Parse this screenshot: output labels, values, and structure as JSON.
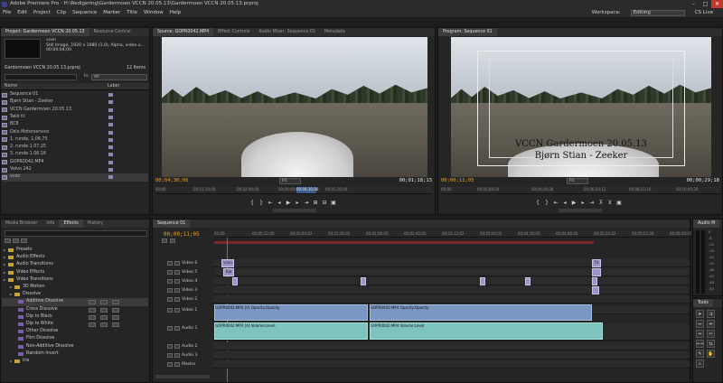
{
  "window": {
    "title": "Adobe Premiere Pro - H:\\Redigering\\Gardermoen VCCN 20.05.13\\Gardermoen VCCN 20.05.13.prproj",
    "minimize": "–",
    "maximize": "□",
    "close": "✕"
  },
  "menu": [
    "File",
    "Edit",
    "Project",
    "Clip",
    "Sequence",
    "Marker",
    "Title",
    "Window",
    "Help"
  ],
  "workspace": {
    "label": "Workspace:",
    "value": "Editing",
    "cs_live": "CS Live"
  },
  "project_panel": {
    "tabs": [
      "Project: Gardermoen VCCN 20.05.13",
      "Resource Central"
    ],
    "clip_name": "vcon",
    "clip_info": "Still Image, 1920 x 1080 (1.0), Alpha",
    "clip_extra": ", video u...",
    "clip_duration": "00;00;04;00",
    "project_file": "Gardermoen VCCN 20.05.13.prproj",
    "items_count": "12 Items",
    "in_label": "In:",
    "in_value": "All",
    "col_name": "Name",
    "col_label": "Label",
    "items": [
      "Sequence 01",
      "Bjørn Stian - Zeeker",
      "VCCN Gardermoen 20.05.13",
      "Takk til",
      "BC8",
      "Oslo Motorservice",
      "1. runde, 1.06.75",
      "2. runde 1.07.25",
      "3. runde 1.06.16",
      "GOPR0042.MP4",
      "Volvo 242",
      "vcon"
    ]
  },
  "source_monitor": {
    "tabs": [
      "Source: GOPR0042.MP4",
      "Effect Controls",
      "Audio Mixer: Sequence 01",
      "Metadata"
    ],
    "timecode_in": "00;04;30;06",
    "fit": "Fit",
    "timecode_dur": "00;01;18;13",
    "ruler": [
      "00;00",
      "00;01;20;00",
      "00;02;40;00",
      "00;04;00;00",
      "00;05;20;00"
    ],
    "ruler_marker": "00;04;30;00"
  },
  "program_monitor": {
    "tabs": [
      "Program: Sequence 01"
    ],
    "timecode_in": "00;00;11;05",
    "fit": "Fit",
    "timecode_dur": "00;00;29;18",
    "title_line1": "VCCN Gardermoen 20.05.13",
    "title_line2": "Bjørn Stian - Zeeker",
    "ruler": [
      "00;00",
      "00;02;08;04",
      "00;04;16;08",
      "00;06;24;12",
      "00;08;32;16",
      "00;10;40;20"
    ]
  },
  "effects_panel": {
    "tabs": [
      "Media Browser",
      "Info",
      "Effects",
      "History"
    ],
    "rows": [
      {
        "t": "Presets",
        "k": "folder"
      },
      {
        "t": "Audio Effects",
        "k": "folder"
      },
      {
        "t": "Audio Transitions",
        "k": "folder"
      },
      {
        "t": "Video Effects",
        "k": "folder"
      },
      {
        "t": "Video Transitions",
        "k": "folder"
      },
      {
        "t": "3D Motion",
        "k": "sub"
      },
      {
        "t": "Dissolve",
        "k": "sub"
      },
      {
        "t": "Additive Dissolve",
        "k": "eff"
      },
      {
        "t": "Cross Dissolve",
        "k": "eff"
      },
      {
        "t": "Dip to Black",
        "k": "eff"
      },
      {
        "t": "Dip to White",
        "k": "eff"
      },
      {
        "t": "Other Dissolve",
        "k": "eff"
      },
      {
        "t": "Film Dissolve",
        "k": "eff"
      },
      {
        "t": "Non-Additive Dissolve",
        "k": "eff"
      },
      {
        "t": "Random Invert",
        "k": "eff"
      },
      {
        "t": "Iris",
        "k": "sub"
      }
    ]
  },
  "timeline": {
    "tab": "Sequence 01",
    "timecode": "00;00;11;05",
    "ruler": [
      "00;00",
      "00;00;12;00",
      "00;01;04;02",
      "00;01;36;02",
      "00;02;08;02",
      "00;02;40;02",
      "00;03;12;02",
      "00;03;44;02",
      "00;04;16;02",
      "00;04;48;02",
      "00;05;20;02",
      "00;05;52;00",
      "00;06;24;02"
    ],
    "video_tracks": [
      "Video 6",
      "Video 5",
      "Video 4",
      "Video 3",
      "Video 2",
      "Video 1"
    ],
    "audio_tracks": [
      "Audio 1",
      "Audio 2",
      "Audio 3",
      "Master"
    ],
    "clip_vcon": "vcon",
    "clip_sm": "Bjø",
    "clip_tit": "Tit",
    "v1_clip1": "GOPR0042.MP4 [V]  Opacity:Opacity",
    "v1_clip2": "GOPR0042.MP4  Opacity:Opacity",
    "a1_clip1": "GOPR0042.MP4 [A]  Volume:Level",
    "a1_clip2": "GOPR0042.MP4  Volume:Level"
  },
  "audio_meter": {
    "tab": "Audio M",
    "scale": [
      "0",
      "-6",
      "-12",
      "-18",
      "-24",
      "-30",
      "-36",
      "-42",
      "-48",
      "-54"
    ]
  },
  "tools_panel": {
    "tab": "Tools"
  }
}
